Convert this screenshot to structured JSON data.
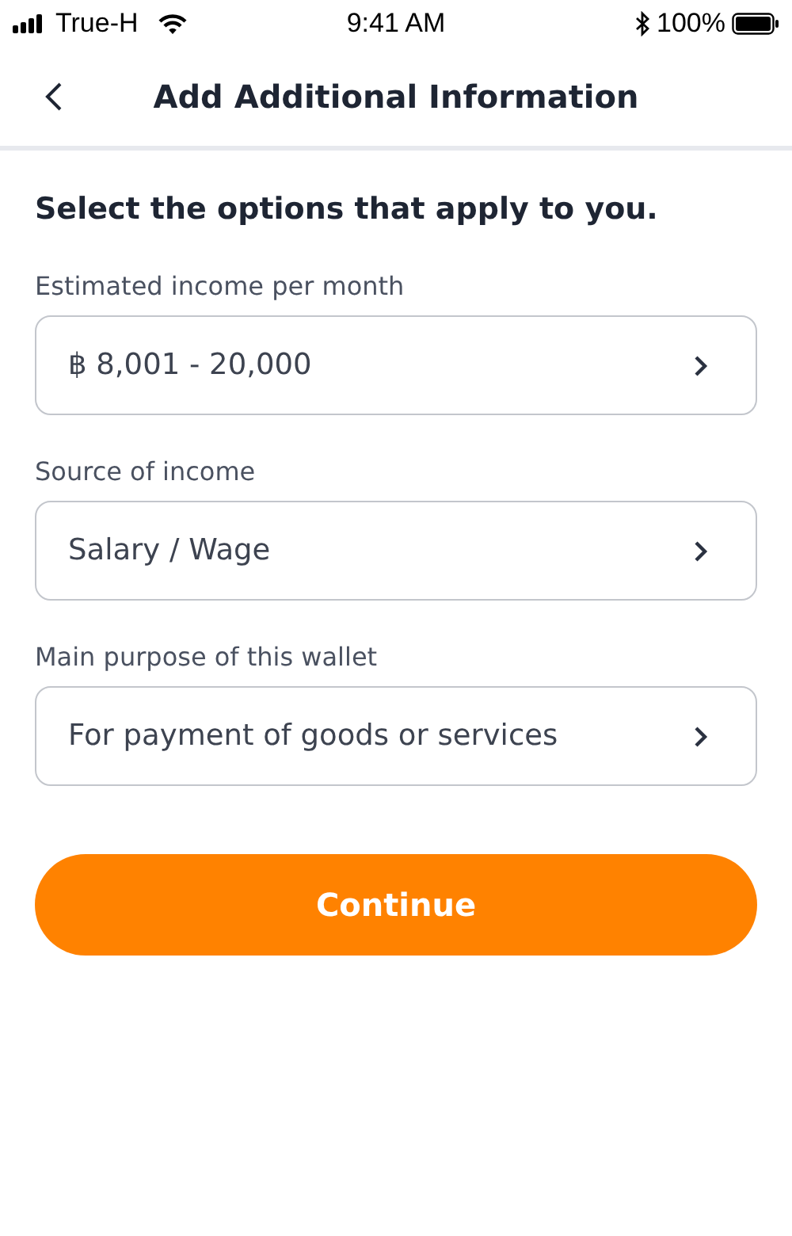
{
  "status_bar": {
    "carrier": "True-H",
    "time": "9:41 AM",
    "battery": "100%"
  },
  "nav": {
    "title": "Add Additional Information"
  },
  "heading": "Select the options that apply to you.",
  "fields": [
    {
      "label": "Estimated income per month",
      "value": "฿ 8,001 - 20,000"
    },
    {
      "label": "Source of income",
      "value": "Salary / Wage"
    },
    {
      "label": "Main purpose of this wallet",
      "value": "For payment of goods or services"
    }
  ],
  "button": "Continue"
}
